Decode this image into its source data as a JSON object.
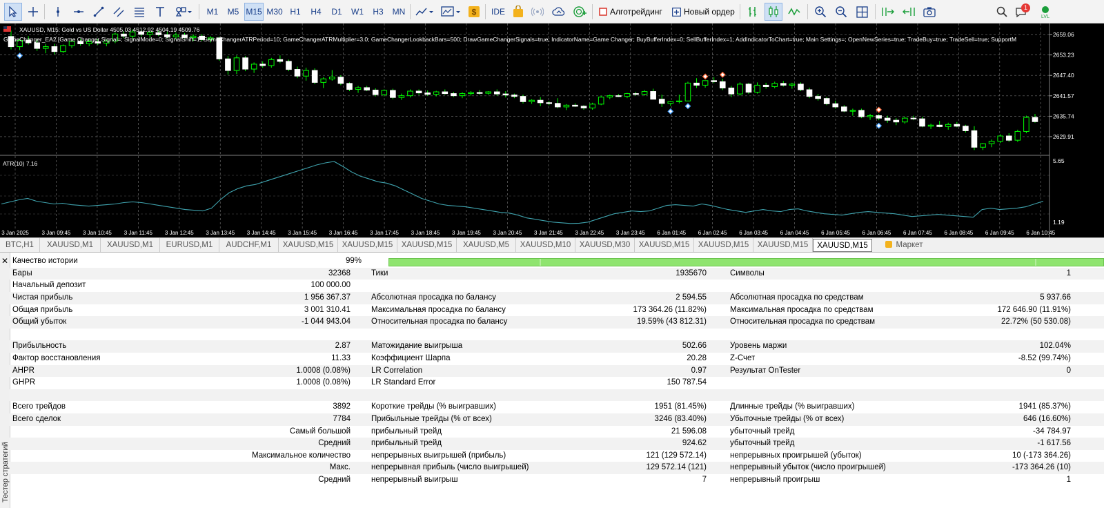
{
  "toolbar": {
    "timeframes": [
      "M1",
      "M5",
      "M15",
      "M30",
      "H1",
      "H4",
      "D1",
      "W1",
      "H3",
      "MN"
    ],
    "active_timeframe": "M15",
    "ide_label": "IDE",
    "algo_label": "Алготрейдинг",
    "new_order_label": "Новый ордер",
    "notification_count": "1",
    "colors": {
      "accent": "#1a3f8a",
      "buy_green": "#1a9e3a",
      "algo_red": "#d9342b",
      "badge_red": "#e53935",
      "gold": "#f3b21d"
    }
  },
  "chart": {
    "header": "XAUUSD, M15:  Gold vs US Dollar  4505.03 4512.92 4504.19 4509.76",
    "ea_line": "GameChanger_EA2 [Game Changer Signal=; SignalMode=0; SignalShift=1; GameChangerATRPeriod=10; GameChangerATRMultiplier=3.0; GameChangerLookbackBars=500; DrawGameChangerSignals=true; IndicatorName=Game Changer; BuyBufferIndex=0; SellBufferIndex=1; AddIndicatorToChart=true; Main Settings=; OpenNewSeries=true; TradeBuy=true; TradeSell=true; SupportM",
    "price_levels": [
      "2659.06",
      "2653.23",
      "2647.40",
      "2641.57",
      "2635.74",
      "2629.91"
    ],
    "atr_label": "ATR(10) 7.16",
    "atr_scale": [
      "5.65",
      "1.19"
    ],
    "time_labels": [
      "3 Jan 2025",
      "3 Jan 09:45",
      "3 Jan 10:45",
      "3 Jan 11:45",
      "3 Jan 12:45",
      "3 Jan 13:45",
      "3 Jan 14:45",
      "3 Jan 15:45",
      "3 Jan 16:45",
      "3 Jan 17:45",
      "3 Jan 18:45",
      "3 Jan 19:45",
      "3 Jan 20:45",
      "3 Jan 21:45",
      "3 Jan 22:45",
      "3 Jan 23:45",
      "6 Jan 01:45",
      "6 Jan 02:45",
      "6 Jan 03:45",
      "6 Jan 04:45",
      "6 Jan 05:45",
      "6 Jan 06:45",
      "6 Jan 07:45",
      "6 Jan 08:45",
      "6 Jan 09:45",
      "6 Jan 10:45"
    ],
    "candles": [
      [
        2658.5,
        2660.2,
        2654.8,
        2655.6
      ],
      [
        2655.6,
        2657.9,
        2654.6,
        2657.4
      ],
      [
        2657.4,
        2658.6,
        2656.2,
        2656.7
      ],
      [
        2656.7,
        2657.6,
        2654.4,
        2655.1
      ],
      [
        2655.1,
        2656.4,
        2653.7,
        2655.6
      ],
      [
        2655.6,
        2656.4,
        2653.4,
        2654.2
      ],
      [
        2654.2,
        2656.2,
        2653.8,
        2655.9
      ],
      [
        2655.9,
        2657.6,
        2655.2,
        2657.1
      ],
      [
        2657.1,
        2657.8,
        2655.9,
        2656.4
      ],
      [
        2656.4,
        2657.6,
        2655.7,
        2657.0
      ],
      [
        2657.0,
        2657.8,
        2656.1,
        2656.6
      ],
      [
        2656.6,
        2657.6,
        2655.7,
        2657.2
      ],
      [
        2657.2,
        2659.6,
        2656.6,
        2659.2
      ],
      [
        2659.2,
        2660.1,
        2658.0,
        2658.6
      ],
      [
        2658.6,
        2660.5,
        2657.8,
        2659.8
      ],
      [
        2659.8,
        2660.4,
        2658.5,
        2659.1
      ],
      [
        2659.1,
        2660.0,
        2658.1,
        2659.6
      ],
      [
        2659.6,
        2660.2,
        2658.6,
        2659.0
      ],
      [
        2659.0,
        2659.9,
        2658.0,
        2658.4
      ],
      [
        2658.4,
        2659.6,
        2657.6,
        2658.9
      ],
      [
        2658.9,
        2659.5,
        2657.9,
        2658.2
      ],
      [
        2658.2,
        2659.1,
        2657.2,
        2658.6
      ],
      [
        2658.6,
        2659.2,
        2657.2,
        2657.6
      ],
      [
        2657.6,
        2658.6,
        2656.8,
        2658.1
      ],
      [
        2658.1,
        2658.4,
        2651.6,
        2652.1
      ],
      [
        2652.1,
        2652.9,
        2647.6,
        2648.8
      ],
      [
        2648.8,
        2653.1,
        2647.8,
        2652.4
      ],
      [
        2652.4,
        2652.9,
        2648.6,
        2649.2
      ],
      [
        2649.2,
        2651.1,
        2648.1,
        2650.6
      ],
      [
        2650.6,
        2651.4,
        2649.6,
        2650.2
      ],
      [
        2650.2,
        2652.4,
        2649.6,
        2651.9
      ],
      [
        2651.9,
        2653.1,
        2650.9,
        2651.4
      ],
      [
        2651.4,
        2651.9,
        2648.6,
        2649.1
      ],
      [
        2649.1,
        2649.9,
        2646.6,
        2647.2
      ],
      [
        2647.2,
        2649.6,
        2645.9,
        2648.8
      ],
      [
        2648.8,
        2649.4,
        2644.9,
        2645.4
      ],
      [
        2645.4,
        2646.9,
        2643.8,
        2646.4
      ],
      [
        2646.4,
        2648.9,
        2645.9,
        2646.9
      ],
      [
        2646.9,
        2647.4,
        2644.6,
        2645.1
      ],
      [
        2645.1,
        2645.4,
        2642.9,
        2643.4
      ],
      [
        2643.4,
        2644.4,
        2642.4,
        2643.9
      ],
      [
        2643.9,
        2644.4,
        2642.9,
        2643.2
      ],
      [
        2643.2,
        2643.7,
        2641.4,
        2641.9
      ],
      [
        2641.9,
        2643.4,
        2641.4,
        2643.1
      ],
      [
        2643.1,
        2643.6,
        2640.6,
        2641.1
      ],
      [
        2641.1,
        2642.2,
        2640.4,
        2641.6
      ],
      [
        2641.6,
        2643.4,
        2641.1,
        2642.9
      ],
      [
        2642.9,
        2643.4,
        2641.9,
        2642.4
      ],
      [
        2642.4,
        2643.1,
        2641.6,
        2642.0
      ],
      [
        2642.0,
        2643.0,
        2641.4,
        2642.7
      ],
      [
        2642.7,
        2643.4,
        2641.9,
        2642.2
      ],
      [
        2642.2,
        2642.7,
        2641.2,
        2641.6
      ],
      [
        2641.6,
        2642.6,
        2640.9,
        2642.2
      ],
      [
        2642.2,
        2642.9,
        2641.6,
        2642.5
      ],
      [
        2642.5,
        2643.2,
        2641.9,
        2642.3
      ],
      [
        2642.3,
        2642.9,
        2641.9,
        2642.7
      ],
      [
        2642.7,
        2643.4,
        2641.6,
        2642.1
      ],
      [
        2642.1,
        2642.9,
        2641.1,
        2641.8
      ],
      [
        2641.8,
        2642.2,
        2640.9,
        2641.4
      ],
      [
        2641.4,
        2641.9,
        2639.4,
        2639.9
      ],
      [
        2639.9,
        2640.6,
        2639.3,
        2640.3
      ],
      [
        2640.3,
        2641.2,
        2638.6,
        2639.6
      ],
      [
        2639.6,
        2640.1,
        2638.9,
        2639.4
      ],
      [
        2639.4,
        2640.9,
        2638.0,
        2638.4
      ],
      [
        2638.4,
        2639.2,
        2637.5,
        2638.9
      ],
      [
        2638.9,
        2639.4,
        2638.4,
        2638.6
      ],
      [
        2638.6,
        2638.9,
        2637.6,
        2638.1
      ],
      [
        2638.1,
        2639.6,
        2637.6,
        2639.2
      ],
      [
        2639.2,
        2641.6,
        2638.9,
        2641.2
      ],
      [
        2641.2,
        2641.9,
        2640.6,
        2641.6
      ],
      [
        2641.6,
        2642.1,
        2641.2,
        2641.4
      ],
      [
        2641.4,
        2642.4,
        2640.9,
        2642.2
      ],
      [
        2642.2,
        2642.7,
        2641.6,
        2642.0
      ],
      [
        2642.0,
        2643.2,
        2641.6,
        2642.8
      ],
      [
        2642.8,
        2643.6,
        2640.9,
        2640.6
      ],
      [
        2640.6,
        2641.9,
        2638.4,
        2639.4
      ],
      [
        2639.4,
        2640.1,
        2638.7,
        2639.9
      ],
      [
        2639.9,
        2641.9,
        2639.4,
        2640.1
      ],
      [
        2640.1,
        2645.6,
        2640.2,
        2645.2
      ],
      [
        2645.2,
        2646.6,
        2643.8,
        2644.6
      ],
      [
        2644.6,
        2645.9,
        2643.9,
        2645.9
      ],
      [
        2645.9,
        2646.9,
        2645.2,
        2645.6
      ],
      [
        2645.6,
        2646.4,
        2643.2,
        2643.8
      ],
      [
        2643.8,
        2644.4,
        2641.2,
        2642.1
      ],
      [
        2642.1,
        2645.4,
        2641.6,
        2644.9
      ],
      [
        2644.9,
        2645.3,
        2642.1,
        2642.6
      ],
      [
        2642.6,
        2645.4,
        2642.2,
        2644.6
      ],
      [
        2644.6,
        2645.3,
        2643.6,
        2644.2
      ],
      [
        2644.2,
        2645.6,
        2643.7,
        2645.1
      ],
      [
        2645.1,
        2645.8,
        2644.2,
        2644.6
      ],
      [
        2644.6,
        2645.3,
        2643.6,
        2644.9
      ],
      [
        2644.9,
        2645.4,
        2642.9,
        2643.3
      ],
      [
        2643.3,
        2643.9,
        2640.9,
        2641.4
      ],
      [
        2641.4,
        2642.1,
        2640.2,
        2640.8
      ],
      [
        2640.8,
        2641.2,
        2638.9,
        2639.3
      ],
      [
        2639.3,
        2640.2,
        2637.9,
        2638.4
      ],
      [
        2638.4,
        2638.9,
        2636.9,
        2637.2
      ],
      [
        2637.2,
        2637.9,
        2635.9,
        2637.4
      ],
      [
        2637.4,
        2637.9,
        2635.2,
        2635.6
      ],
      [
        2635.6,
        2636.4,
        2634.7,
        2635.9
      ],
      [
        2635.9,
        2636.4,
        2634.6,
        2635.2
      ],
      [
        2635.2,
        2635.9,
        2633.9,
        2634.6
      ],
      [
        2634.6,
        2635.2,
        2633.2,
        2634.1
      ],
      [
        2634.1,
        2635.6,
        2633.6,
        2635.2
      ],
      [
        2635.2,
        2635.9,
        2634.6,
        2635.0
      ],
      [
        2635.0,
        2635.6,
        2632.6,
        2632.9
      ],
      [
        2632.9,
        2633.6,
        2632.1,
        2633.2
      ],
      [
        2633.2,
        2634.4,
        2632.6,
        2632.8
      ],
      [
        2632.8,
        2633.9,
        2631.9,
        2633.4
      ],
      [
        2633.4,
        2634.1,
        2632.6,
        2632.9
      ],
      [
        2632.9,
        2633.3,
        2631.1,
        2631.6
      ],
      [
        2631.6,
        2632.9,
        2626.1,
        2626.9
      ],
      [
        2626.9,
        2628.1,
        2626.1,
        2627.9
      ],
      [
        2627.9,
        2629.1,
        2626.9,
        2628.6
      ],
      [
        2628.6,
        2630.6,
        2628.1,
        2630.1
      ],
      [
        2630.1,
        2630.9,
        2628.4,
        2628.9
      ],
      [
        2628.9,
        2631.9,
        2628.4,
        2631.4
      ],
      [
        2631.4,
        2635.9,
        2630.9,
        2635.4
      ],
      [
        2635.4,
        2636.4,
        2633.9,
        2634.2
      ]
    ],
    "atr_values": [
      2.6,
      2.75,
      2.9,
      3.0,
      2.8,
      2.7,
      2.6,
      2.65,
      2.55,
      2.5,
      2.45,
      2.5,
      2.55,
      2.6,
      2.7,
      2.75,
      2.7,
      2.6,
      2.5,
      2.4,
      2.3,
      2.2,
      2.15,
      2.1,
      2.3,
      2.9,
      3.4,
      3.7,
      3.9,
      4.0,
      4.2,
      4.4,
      4.6,
      4.8,
      5.0,
      5.2,
      5.4,
      5.55,
      5.65,
      5.3,
      4.9,
      4.6,
      4.4,
      4.2,
      4.1,
      3.9,
      3.6,
      3.3,
      3.0,
      2.8,
      2.6,
      2.5,
      2.45,
      2.4,
      2.3,
      2.2,
      2.1,
      2.0,
      1.95,
      1.8,
      1.6,
      1.5,
      1.4,
      1.3,
      1.25,
      1.2,
      1.22,
      1.3,
      1.5,
      1.7,
      1.9,
      2.0,
      2.1,
      2.05,
      2.1,
      2.3,
      2.5,
      2.55,
      2.5,
      2.45,
      2.6,
      2.5,
      2.35,
      2.2,
      2.1,
      2.0,
      2.1,
      2.2,
      2.1,
      2.05,
      2.2,
      2.25,
      2.1,
      2.0,
      1.9,
      1.85,
      1.8,
      1.9,
      2.0,
      2.05,
      2.0,
      1.95,
      1.9,
      1.8,
      1.7,
      1.75,
      1.8,
      1.85,
      1.8,
      1.75,
      1.7,
      1.65,
      2.2,
      2.3,
      2.2,
      2.25,
      2.3,
      2.4,
      2.6,
      2.8
    ]
  },
  "tabs": [
    "BTC,H1",
    "XAUUSD,M1",
    "XAUUSD,M1",
    "EURUSD,M1",
    "AUDCHF,M1",
    "XAUUSD,M15",
    "XAUUSD,M15",
    "XAUUSD,M15",
    "XAUUSD,M5",
    "XAUUSD,M10",
    "XAUUSD,M30",
    "XAUUSD,M15",
    "XAUUSD,M15",
    "XAUUSD,M15",
    "XAUUSD,M15"
  ],
  "active_tab": "XAUUSD,M15",
  "market_tab": "Маркет",
  "report": {
    "sidebar_title": "Тестер стратегий",
    "history_quality_label": "Качество истории",
    "history_quality_value": "99%",
    "history_quality_fill": 1.0,
    "rows": [
      {
        "shade": true,
        "c1": "Бары",
        "v1": "32368",
        "c2": "Тики",
        "v2": "1935670",
        "c3": "Символы",
        "v3": "1"
      },
      {
        "shade": false,
        "c1": "Начальный депозит",
        "v1": "100 000.00",
        "c2": "",
        "v2": "",
        "c3": "",
        "v3": ""
      },
      {
        "shade": true,
        "c1": "Чистая прибыль",
        "v1": "1 956 367.37",
        "c2": "Абсолютная просадка по балансу",
        "v2": "2 594.55",
        "c3": "Абсолютная просадка по средствам",
        "v3": "5 937.66"
      },
      {
        "shade": false,
        "c1": "Общая прибыль",
        "v1": "3 001 310.41",
        "c2": "Максимальная просадка по балансу",
        "v2": "173 364.26 (11.82%)",
        "c3": "Максимальная просадка по средствам",
        "v3": "172 646.90 (11.91%)"
      },
      {
        "shade": true,
        "c1": "Общий убыток",
        "v1": "-1 044 943.04",
        "c2": "Относительная просадка по балансу",
        "v2": "19.59% (43 812.31)",
        "c3": "Относительная просадка по средствам",
        "v3": "22.72% (50 530.08)"
      },
      {
        "shade": false,
        "c1": "",
        "v1": "",
        "c2": "",
        "v2": "",
        "c3": "",
        "v3": ""
      },
      {
        "shade": true,
        "c1": "Прибыльность",
        "v1": "2.87",
        "c2": "Матожидание выигрыша",
        "v2": "502.66",
        "c3": "Уровень маржи",
        "v3": "102.04%"
      },
      {
        "shade": false,
        "c1": "Фактор восстановления",
        "v1": "11.33",
        "c2": "Коэффициент Шарпа",
        "v2": "20.28",
        "c3": "Z-Счет",
        "v3": "-8.52 (99.74%)"
      },
      {
        "shade": true,
        "c1": "AHPR",
        "v1": "1.0008 (0.08%)",
        "c2": "LR Correlation",
        "v2": "0.97",
        "c3": "Результат OnTester",
        "v3": "0"
      },
      {
        "shade": false,
        "c1": "GHPR",
        "v1": "1.0008 (0.08%)",
        "c2": "LR Standard Error",
        "v2": "150 787.54",
        "c3": "",
        "v3": ""
      },
      {
        "shade": true,
        "c1": "",
        "v1": "",
        "c2": "",
        "v2": "",
        "c3": "",
        "v3": ""
      },
      {
        "shade": false,
        "c1": "Всего трейдов",
        "v1": "3892",
        "c2": "Короткие трейды (% выигравших)",
        "v2": "1951 (81.45%)",
        "c3": "Длинные трейды (% выигравших)",
        "v3": "1941 (85.37%)"
      },
      {
        "shade": true,
        "c1": "Всего сделок",
        "v1": "7784",
        "c2": "Прибыльные трейды (% от всех)",
        "v2": "3246 (83.40%)",
        "c3": "Убыточные трейды (% от всех)",
        "v3": "646 (16.60%)"
      },
      {
        "shade": false,
        "c1r": "Самый большой",
        "c2": "прибыльный трейд",
        "v2": "21 596.08",
        "c3": "убыточный трейд",
        "v3": "-34 784.97"
      },
      {
        "shade": true,
        "c1r": "Средний",
        "c2": "прибыльный трейд",
        "v2": "924.62",
        "c3": "убыточный трейд",
        "v3": "-1 617.56"
      },
      {
        "shade": false,
        "c1r": "Максимальное количество",
        "c2": "непрерывных выигрышей (прибыль)",
        "v2": "121 (129 572.14)",
        "c3": "непрерывных проигрышей (убыток)",
        "v3": "10 (-173 364.26)"
      },
      {
        "shade": true,
        "c1r": "Макс.",
        "c2": "непрерывная прибыль (число выигрышей)",
        "v2": "129 572.14 (121)",
        "c3": "непрерывный убыток (число проигрышей)",
        "v3": "-173 364.26 (10)"
      },
      {
        "shade": false,
        "c1r": "Средний",
        "c2": "непрерывный выигрыш",
        "v2": "7",
        "c3": "непрерывный проигрыш",
        "v3": "1"
      }
    ]
  }
}
